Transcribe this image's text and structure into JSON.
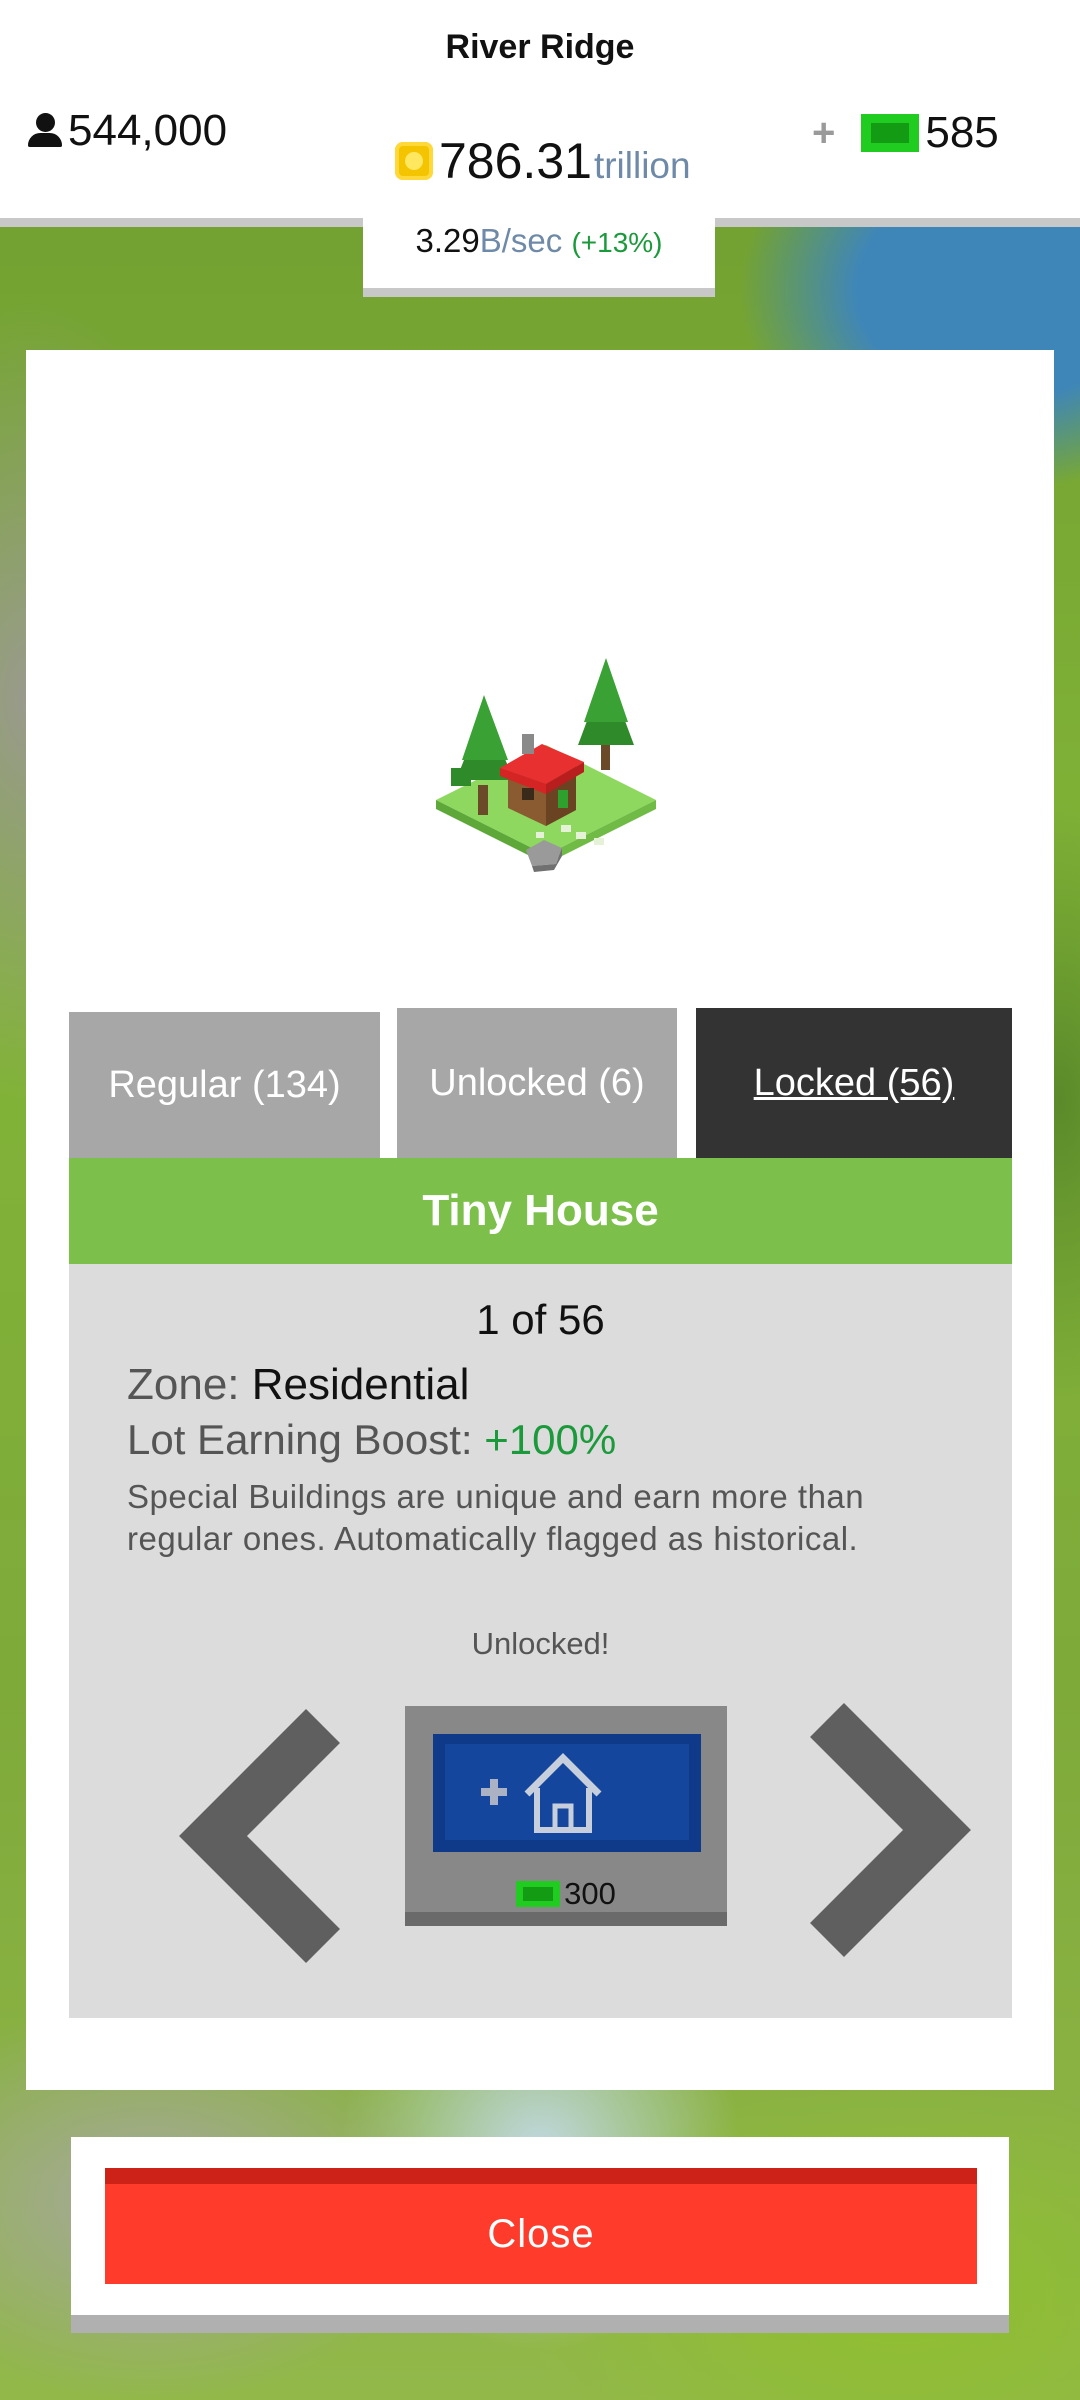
{
  "header": {
    "city_name": "River Ridge",
    "population": "544,000",
    "coins_value": "786.31",
    "coins_unit": "trillion",
    "income_value": "3.29",
    "income_unit": "B/sec",
    "income_pct": "(+13%)",
    "gems": "585",
    "plus_label": "+"
  },
  "tabs": [
    {
      "label": "Regular (134)",
      "active": false
    },
    {
      "label": "Unlocked (6)",
      "active": false
    },
    {
      "label": "Locked (56)",
      "active": true
    }
  ],
  "building": {
    "name": "Tiny House",
    "counter": "1 of 56",
    "zone_label": "Zone:",
    "zone_value": "Residential",
    "boost_label": "Lot Earning Boost:",
    "boost_value": "+100%",
    "description": "Special Buildings are unique and earn more than regular ones. Automatically flagged as historical.",
    "status": "Unlocked!",
    "price": "300",
    "buy_icon": "add-house-icon"
  },
  "close_label": "Close",
  "colors": {
    "tab_active": "#333333",
    "tab_inactive": "#a7a7a7",
    "title_bar": "#7cc04b",
    "close_button": "#ff3b2b",
    "boost_green": "#1b9a3b",
    "buy_blue": "#14469e"
  }
}
